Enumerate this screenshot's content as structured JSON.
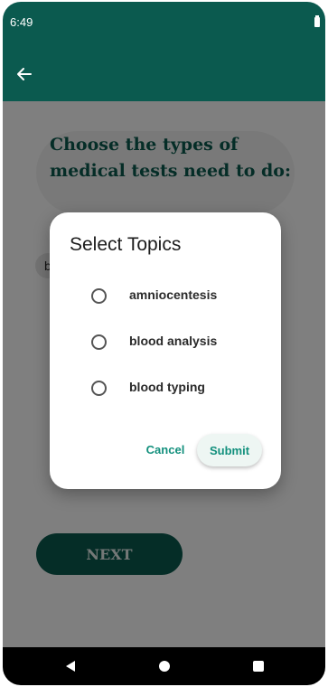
{
  "status_bar": {
    "time": "6:49",
    "battery_icon": "battery-icon"
  },
  "app_bar": {
    "back_icon": "arrow-left-icon"
  },
  "main": {
    "title": "Choose the types of medical tests need to do:",
    "selected_chip": "b",
    "next_label": "NEXT"
  },
  "dialog": {
    "title": "Select Topics",
    "options": [
      {
        "label": "amniocentesis",
        "selected": false
      },
      {
        "label": "blood analysis",
        "selected": false
      },
      {
        "label": "blood typing",
        "selected": false
      }
    ],
    "cancel_label": "Cancel",
    "submit_label": "Submit"
  },
  "nav_bar": {
    "icons": [
      "back-triangle-icon",
      "home-circle-icon",
      "recents-square-icon"
    ]
  },
  "colors": {
    "primary": "#0b5a4f",
    "accent": "#13907d",
    "scrim": "rgba(0,0,0,0.5)"
  }
}
